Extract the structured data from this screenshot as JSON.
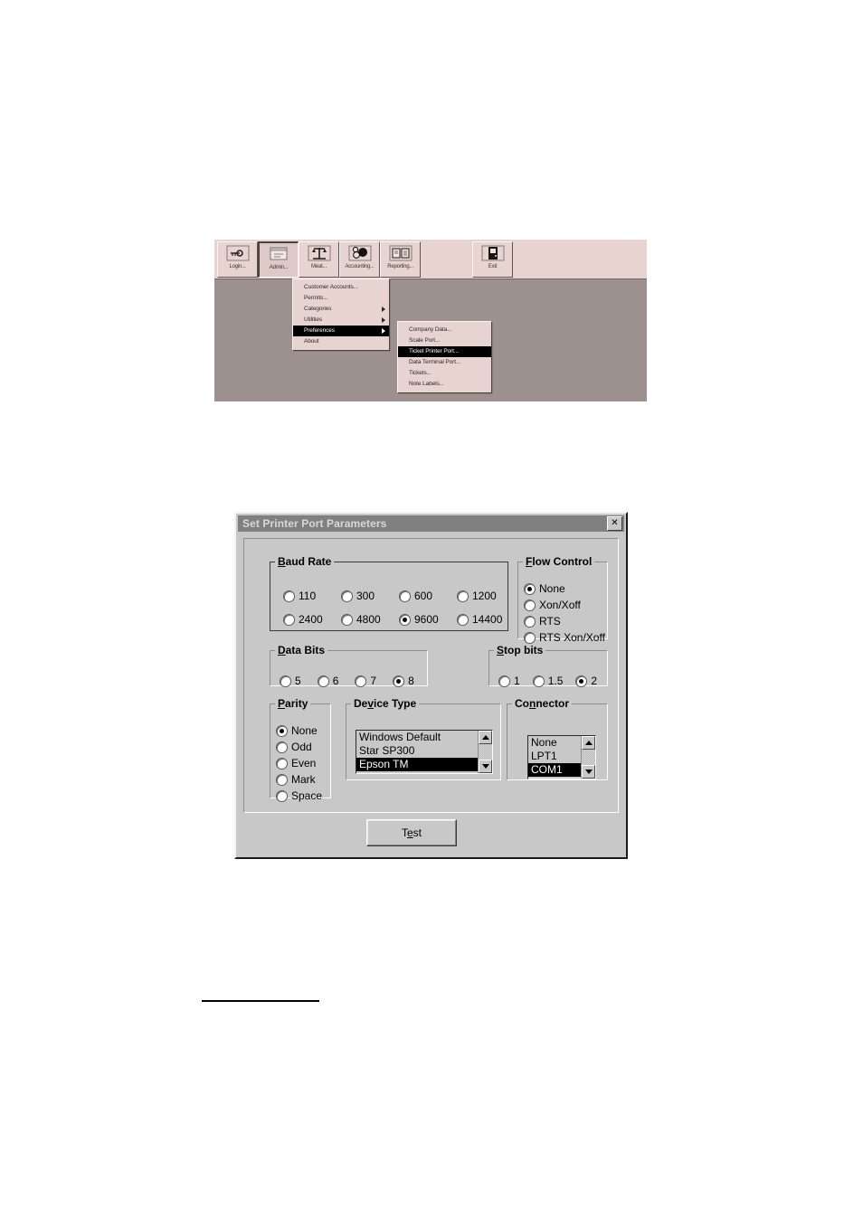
{
  "figure_menu": {
    "toolbar": {
      "buttons": [
        {
          "label": "Login...",
          "icon": "key-icon",
          "pressed": false
        },
        {
          "label": "Admin...",
          "icon": "window-icon",
          "pressed": true
        },
        {
          "label": "Meat...",
          "icon": "scale-icon",
          "pressed": false
        },
        {
          "label": "Accounting...",
          "icon": "coins-icon",
          "pressed": false
        },
        {
          "label": "Reporting...",
          "icon": "report-icon",
          "pressed": false
        }
      ],
      "buttons_right": [
        {
          "label": "Exit",
          "icon": "door-exit-icon",
          "pressed": false
        }
      ]
    },
    "admin_menu": {
      "items": [
        {
          "label": "Customer Accounts...",
          "submenu": false,
          "selected": false
        },
        {
          "label": "Permits...",
          "submenu": false,
          "selected": false
        },
        {
          "label": "Categories",
          "submenu": true,
          "selected": false
        },
        {
          "label": "Utilities",
          "submenu": true,
          "selected": false
        },
        {
          "label": "Preferences",
          "submenu": true,
          "selected": true
        },
        {
          "label": "About",
          "submenu": false,
          "selected": false
        }
      ]
    },
    "preferences_menu": {
      "items": [
        {
          "label": "Company Data...",
          "selected": false
        },
        {
          "label": "Scale Port...",
          "selected": false
        },
        {
          "label": "Ticket Printer Port...",
          "selected": true
        },
        {
          "label": "Data Terminal Port...",
          "selected": false
        },
        {
          "label": "Tickets...",
          "selected": false
        },
        {
          "label": "Note Labels...",
          "selected": false
        }
      ]
    },
    "colors": {
      "toolbar_bg": "#e7d4d1",
      "client_bg": "#9c918e",
      "menu_bg": "#e7d4d1",
      "highlight_bg": "#000000",
      "highlight_fg": "#ffffff"
    }
  },
  "dialog": {
    "title": "Set Printer Port Parameters",
    "close_label": "✕",
    "baud_rate": {
      "legend": "Baud Rate",
      "options": [
        "110",
        "300",
        "600",
        "1200",
        "2400",
        "4800",
        "9600",
        "14400"
      ],
      "selected": "9600"
    },
    "flow_control": {
      "legend": "Flow Control",
      "options": [
        "None",
        "Xon/Xoff",
        "RTS",
        "RTS Xon/Xoff"
      ],
      "selected": "None"
    },
    "data_bits": {
      "legend": "Data Bits",
      "options": [
        "5",
        "6",
        "7",
        "8"
      ],
      "selected": "8"
    },
    "stop_bits": {
      "legend": "Stop bits",
      "options": [
        "1",
        "1.5",
        "2"
      ],
      "selected": "2"
    },
    "parity": {
      "legend": "Parity",
      "options": [
        "None",
        "Odd",
        "Even",
        "Mark",
        "Space"
      ],
      "selected": "None"
    },
    "device_type": {
      "legend": "Device Type",
      "options": [
        "Windows Default",
        "Star SP300",
        "Epson TM"
      ],
      "selected": "Epson TM"
    },
    "connector": {
      "legend": "Connector",
      "options": [
        "None",
        "LPT1",
        "COM1"
      ],
      "selected": "COM1"
    },
    "test_button": "Test",
    "colors": {
      "face": "#c8c8c8",
      "titlebar": "#808080",
      "titlebar_text": "#d8d8d8",
      "selection": "#000000"
    }
  }
}
